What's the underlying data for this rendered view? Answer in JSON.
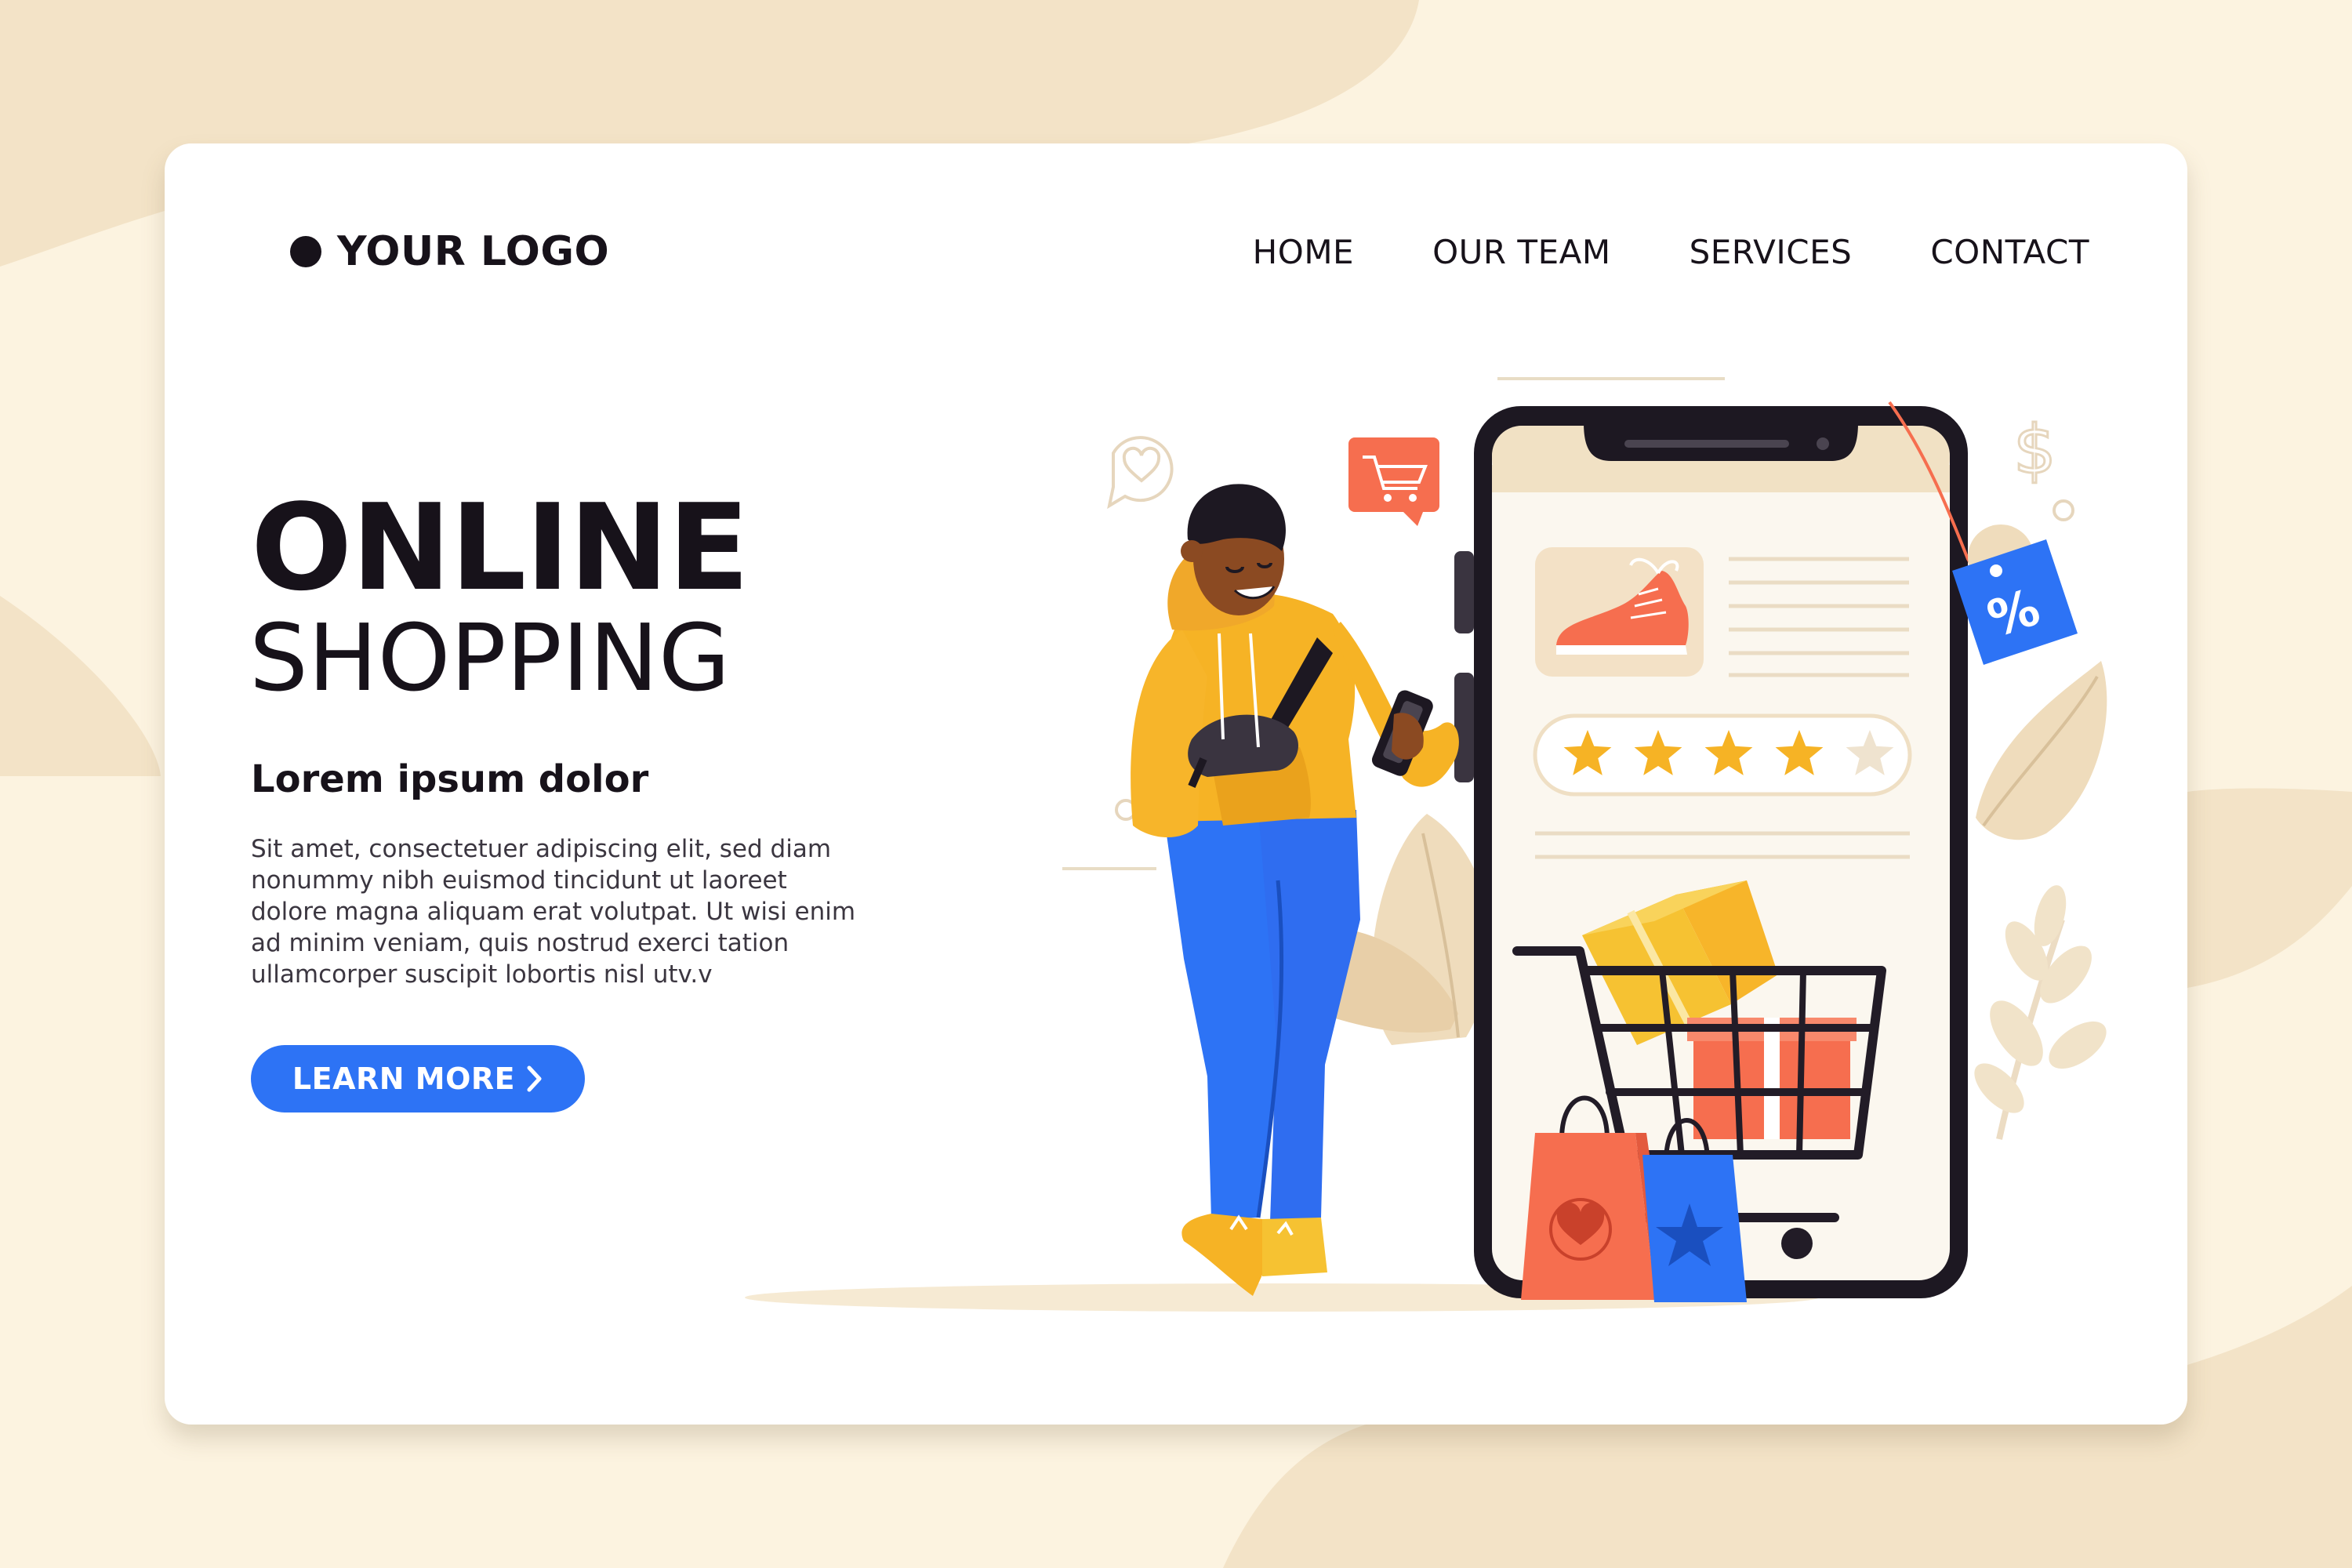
{
  "header": {
    "logo_text": "YOUR LOGO",
    "nav": [
      {
        "label": "HOME"
      },
      {
        "label": "OUR TEAM"
      },
      {
        "label": "SERVICES"
      },
      {
        "label": "CONTACT"
      }
    ]
  },
  "hero": {
    "title_line1": "ONLINE",
    "title_line2": "SHOPPING",
    "subtitle": "Lorem ipsum dolor",
    "body_lines": [
      "Sit amet, consectetuer adipiscing elit, sed diam",
      "nonummy nibh euismod tincidunt ut laoreet",
      "dolore magna aliquam erat volutpat. Ut wisi enim",
      "ad minim veniam, quis nostrud exerci tation",
      "ullamcorper suscipit lobortis nisl utv.v"
    ],
    "cta_label": "LEARN MORE"
  },
  "illustration": {
    "discount_tag_text": "%",
    "rating": 4,
    "rating_max": 5
  },
  "colors": {
    "background": "#fcf3e0",
    "background_shape": "#f3e3c7",
    "card": "#ffffff",
    "text_dark": "#17121a",
    "accent_blue": "#2d73f5",
    "hoodie_yellow": "#f6b325",
    "star_yellow": "#f6b325",
    "coral": "#f66e4f"
  },
  "icons": [
    "dollar-icon",
    "heart-chat-icon",
    "cart-chat-icon",
    "chevron-right-icon",
    "star-icon",
    "shopping-cart-icon"
  ]
}
